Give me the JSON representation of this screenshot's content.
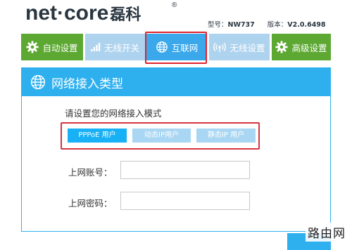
{
  "header": {
    "logo_text": "net",
    "logo_dot": "·",
    "logo_text2": "core",
    "logo_cn": "磊科",
    "logo_reg": "®",
    "model_label": "型号：",
    "model_value": "NW737",
    "version_label": "版本：",
    "version_value": "V2.0.6498"
  },
  "nav": {
    "tabs": [
      {
        "label": "自动设置",
        "icon": "gear-icon"
      },
      {
        "label": "无线开关",
        "icon": "signal-bars-icon"
      },
      {
        "label": "互联网",
        "icon": "globe-icon"
      },
      {
        "label": "无线设置",
        "icon": "wifi-icon"
      },
      {
        "label": "高级设置",
        "icon": "gear-icon"
      }
    ],
    "active_tab": "互联网"
  },
  "panel": {
    "title": "网络接入类型",
    "mode_prompt": "请设置您的网络接入模式",
    "modes": [
      {
        "label": "PPPoE 用户"
      },
      {
        "label": "动态IP用户"
      },
      {
        "label": "静态IP 用户"
      }
    ],
    "selected_mode": "PPPoE 用户",
    "account_label": "上网账号：",
    "account_value": "",
    "password_label": "上网密码：",
    "password_value": ""
  },
  "watermark": "路由网",
  "colors": {
    "green": "#5ca832",
    "blue": "#2fb0ee",
    "light_blue": "#aed3ee",
    "highlight_red": "#e0222c"
  }
}
